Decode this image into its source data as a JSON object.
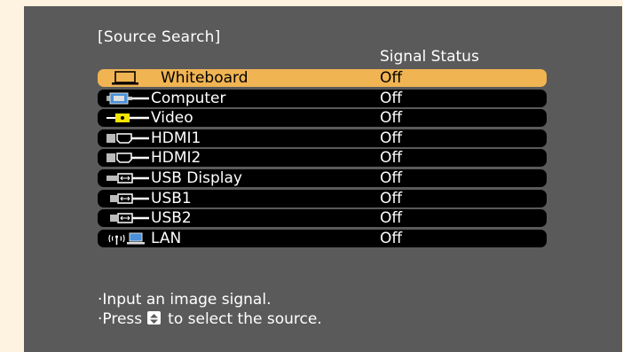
{
  "dialog": {
    "title": "[Source Search]",
    "status_header": "Signal Status"
  },
  "sources": [
    {
      "label": "Whiteboard",
      "status": "Off",
      "icon": "whiteboard-icon",
      "selected": true
    },
    {
      "label": "Computer",
      "status": "Off",
      "icon": "computer-cable-icon"
    },
    {
      "label": "Video",
      "status": "Off",
      "icon": "video-cable-icon"
    },
    {
      "label": "HDMI1",
      "status": "Off",
      "icon": "hdmi-cable-icon"
    },
    {
      "label": "HDMI2",
      "status": "Off",
      "icon": "hdmi-cable-icon"
    },
    {
      "label": "USB Display",
      "status": "Off",
      "icon": "usb-cable-icon"
    },
    {
      "label": "USB1",
      "status": "Off",
      "icon": "usb-cable-icon"
    },
    {
      "label": "USB2",
      "status": "Off",
      "icon": "usb-cable-icon"
    },
    {
      "label": "LAN",
      "status": "Off",
      "icon": "wireless-lan-icon"
    }
  ],
  "hints": {
    "line1": "·Input an image signal.",
    "line2_prefix": "·Press",
    "line2_suffix": "to select the source."
  },
  "colors": {
    "selection": "#f0b452",
    "panel": "#5a5a5a",
    "row": "#000000",
    "video_connector": "#f5e400",
    "computer_connector": "#4a90d9"
  }
}
